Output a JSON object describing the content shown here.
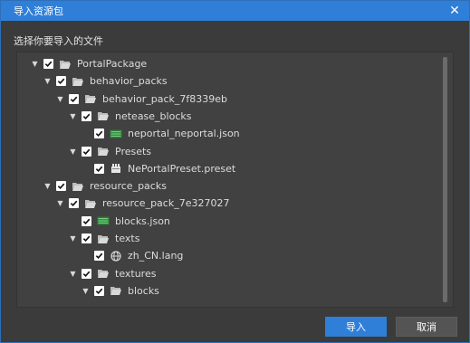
{
  "window": {
    "title": "导入资源包",
    "close_glyph": "✕"
  },
  "prompt": "选择你要导入的文件",
  "colors": {
    "titlebar": "#2f7fd8",
    "background": "#3b3b3b",
    "panel": "#414141",
    "check": "#ffffff",
    "folder": "#cfcfcf",
    "json_icon": "#3aa24a"
  },
  "tree": [
    {
      "label": "PortalPackage",
      "expanded": true,
      "icon": "folder-open-icon",
      "checked": true
    },
    {
      "label": "behavior_packs",
      "expanded": true,
      "icon": "folder-open-icon",
      "checked": true
    },
    {
      "label": "behavior_pack_7f8339eb",
      "expanded": true,
      "icon": "folder-open-icon",
      "checked": true
    },
    {
      "label": "netease_blocks",
      "expanded": true,
      "icon": "folder-open-icon",
      "checked": true
    },
    {
      "label": "neportal_neportal.json",
      "expanded": null,
      "icon": "json-file-icon",
      "checked": true
    },
    {
      "label": "Presets",
      "expanded": true,
      "icon": "folder-open-icon",
      "checked": true
    },
    {
      "label": "NePortalPreset.preset",
      "expanded": null,
      "icon": "preset-file-icon",
      "checked": true
    },
    {
      "label": "resource_packs",
      "expanded": true,
      "icon": "folder-open-icon",
      "checked": true
    },
    {
      "label": "resource_pack_7e327027",
      "expanded": true,
      "icon": "folder-open-icon",
      "checked": true
    },
    {
      "label": "blocks.json",
      "expanded": null,
      "icon": "json-file-icon",
      "checked": true
    },
    {
      "label": "texts",
      "expanded": true,
      "icon": "folder-open-icon",
      "checked": true
    },
    {
      "label": "zh_CN.lang",
      "expanded": null,
      "icon": "globe-icon",
      "checked": true
    },
    {
      "label": "textures",
      "expanded": true,
      "icon": "folder-open-icon",
      "checked": true
    },
    {
      "label": "blocks",
      "expanded": true,
      "icon": "folder-open-icon",
      "checked": true
    }
  ],
  "buttons": {
    "import": "导入",
    "cancel": "取消"
  }
}
